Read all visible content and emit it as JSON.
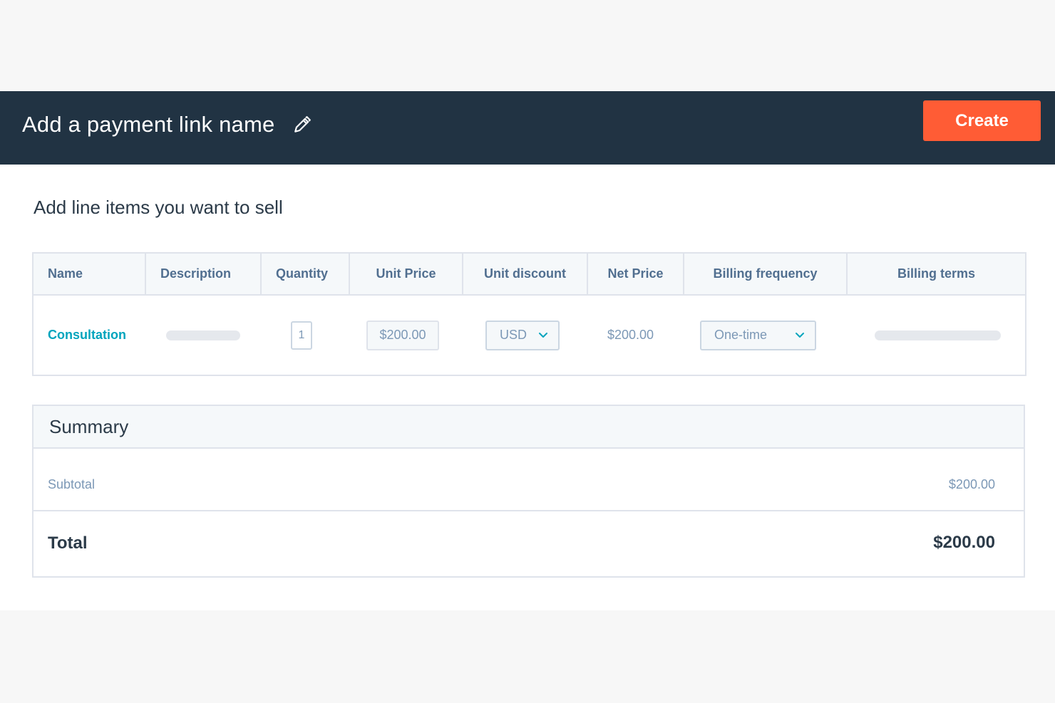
{
  "header": {
    "title": "Add a payment link name",
    "edit_icon": "pencil-icon",
    "create_label": "Create",
    "background": "#213343",
    "accent": "#ff5c35"
  },
  "section": {
    "title": "Add line items you want to sell"
  },
  "line_items": {
    "columns": [
      "Name",
      "Description",
      "Quantity",
      "Unit Price",
      "Unit discount",
      "Net Price",
      "Billing frequency",
      "Billing terms"
    ],
    "rows": [
      {
        "name": "Consultation",
        "quantity": "1",
        "unit_price": "$200.00",
        "discount_currency": "USD",
        "net_price": "$200.00",
        "billing_frequency": "One-time"
      }
    ]
  },
  "summary": {
    "title": "Summary",
    "subtotal_label": "Subtotal",
    "subtotal_value": "$200.00",
    "total_label": "Total",
    "total_value": "$200.00"
  },
  "colors": {
    "link": "#00a4bd",
    "border": "#dfe3eb",
    "muted_text": "#7c98b6"
  }
}
